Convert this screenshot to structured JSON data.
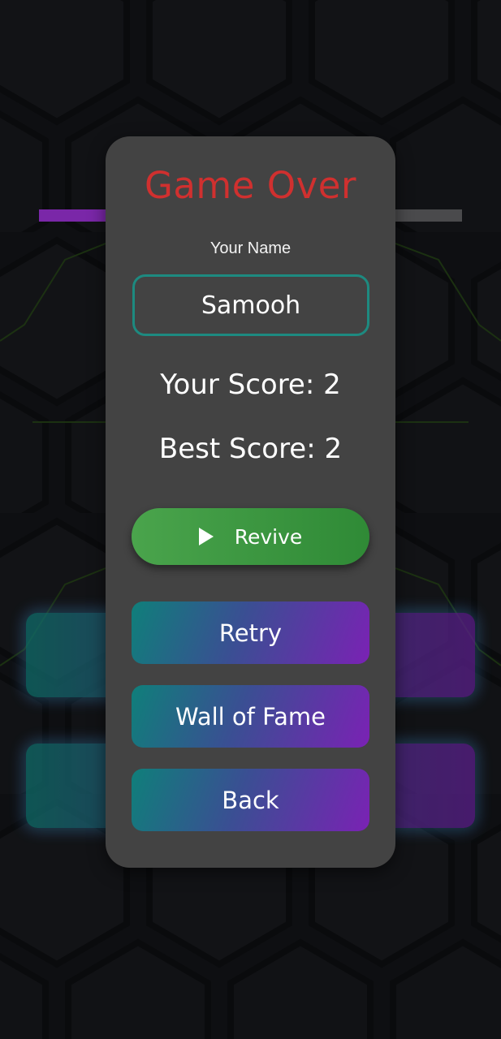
{
  "dialog": {
    "title": "Game Over",
    "name_label": "Your Name",
    "name_value": "Samooh",
    "your_score": "Your Score: 2",
    "best_score": "Best Score: 2"
  },
  "buttons": {
    "revive": "Revive",
    "retry": "Retry",
    "wall_of_fame": "Wall of Fame",
    "back": "Back"
  },
  "icons": {
    "revive_icon": "play-icon"
  },
  "colors": {
    "title": "#d0302f",
    "field_border": "#1d8a80",
    "revive_green": "#3e9a42",
    "gradient_start": "#0f7f7a",
    "gradient_end": "#7a22b4",
    "panel": "#434343"
  }
}
